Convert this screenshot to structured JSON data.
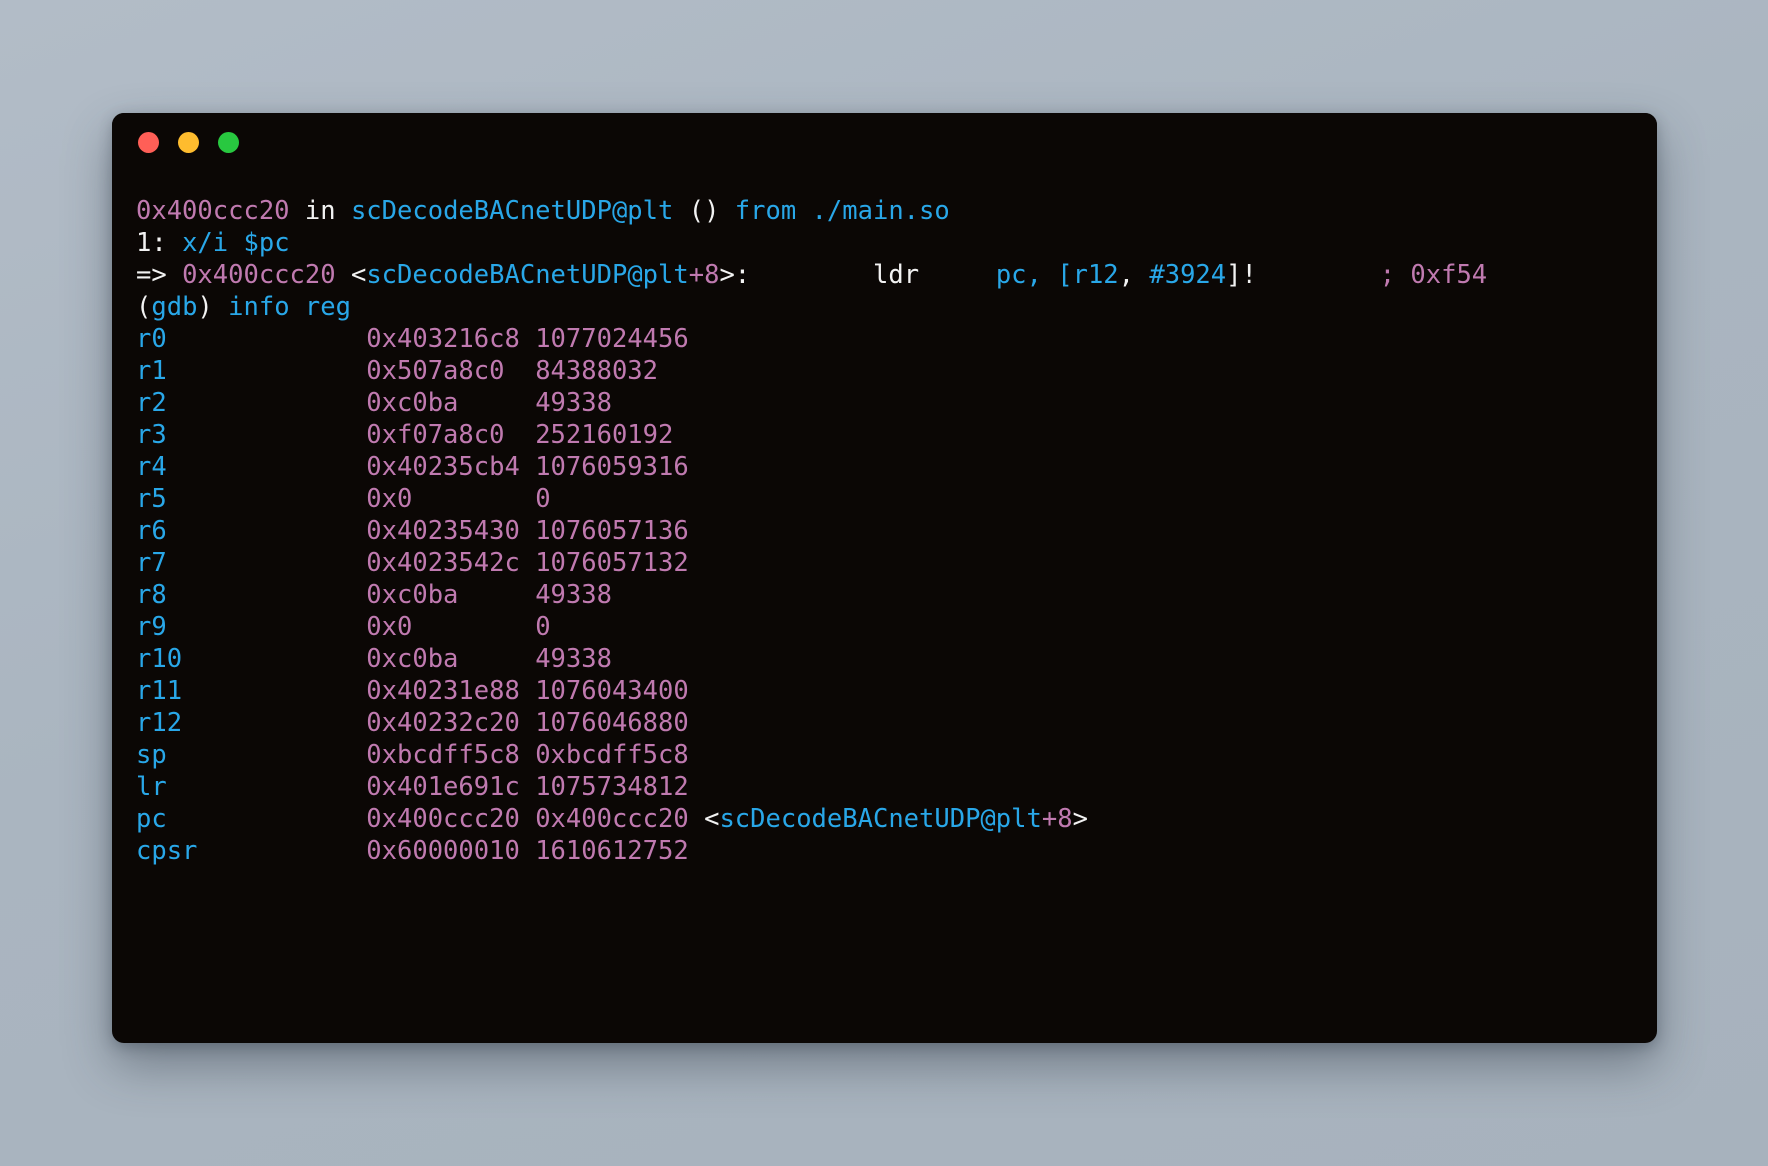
{
  "window": {
    "background_color": "#aeb9c4",
    "terminal_bg": "#0b0705",
    "titlebar": {
      "close_label": "",
      "minimize_label": "",
      "maximize_label": "",
      "close_color": "#ff5f57",
      "minimize_color": "#febc2e",
      "maximize_color": "#28c840"
    }
  },
  "colors": {
    "text": "#f2f2f2",
    "symbol_blue": "#29a7e8",
    "value_pink": "#c07ab0"
  },
  "terminal": {
    "stop_line": {
      "address": "0x400ccc20",
      "in_kw": " in ",
      "symbol": "scDecodeBACnetUDP@plt",
      "parens": " () ",
      "from_kw": "from",
      "space": " ",
      "object": "./main.so"
    },
    "display_line": {
      "number": "1: ",
      "command": "x/i",
      "space": " ",
      "register": "$pc"
    },
    "disasm_line": {
      "arrow": "=> ",
      "address": "0x400ccc20",
      "space1": " ",
      "lt": "<",
      "symbol": "scDecodeBACnetUDP",
      "plt": "@plt",
      "plus": "+8",
      "gt": ">:",
      "gap1": "        ",
      "mnemonic": "ldr",
      "gap2": "     ",
      "operands_pre": "pc, [",
      "reg_operand": "r12",
      "operands_mid": ", ",
      "immediate": "#3924",
      "operands_post": "]!",
      "gap3": "        ",
      "comment": "; 0xf54"
    },
    "prompt_line": {
      "open_paren": "(",
      "prompt": "gdb",
      "close_paren": ")",
      "space": " ",
      "command": "info reg"
    },
    "register_table": {
      "columns": [
        "name",
        "hex",
        "decimal",
        "annotation"
      ],
      "rows": [
        {
          "name": "r0",
          "hex": "0x403216c8",
          "decimal": "1077024456",
          "annotation": ""
        },
        {
          "name": "r1",
          "hex": "0x507a8c0",
          "decimal": "84388032",
          "annotation": ""
        },
        {
          "name": "r2",
          "hex": "0xc0ba",
          "decimal": "49338",
          "annotation": ""
        },
        {
          "name": "r3",
          "hex": "0xf07a8c0",
          "decimal": "252160192",
          "annotation": ""
        },
        {
          "name": "r4",
          "hex": "0x40235cb4",
          "decimal": "1076059316",
          "annotation": ""
        },
        {
          "name": "r5",
          "hex": "0x0",
          "decimal": "0",
          "annotation": ""
        },
        {
          "name": "r6",
          "hex": "0x40235430",
          "decimal": "1076057136",
          "annotation": ""
        },
        {
          "name": "r7",
          "hex": "0x4023542c",
          "decimal": "1076057132",
          "annotation": ""
        },
        {
          "name": "r8",
          "hex": "0xc0ba",
          "decimal": "49338",
          "annotation": ""
        },
        {
          "name": "r9",
          "hex": "0x0",
          "decimal": "0",
          "annotation": ""
        },
        {
          "name": "r10",
          "hex": "0xc0ba",
          "decimal": "49338",
          "annotation": ""
        },
        {
          "name": "r11",
          "hex": "0x40231e88",
          "decimal": "1076043400",
          "annotation": ""
        },
        {
          "name": "r12",
          "hex": "0x40232c20",
          "decimal": "1076046880",
          "annotation": ""
        },
        {
          "name": "sp",
          "hex": "0xbcdff5c8",
          "decimal": "0xbcdff5c8",
          "annotation": ""
        },
        {
          "name": "lr",
          "hex": "0x401e691c",
          "decimal": "1075734812",
          "annotation": ""
        },
        {
          "name": "pc",
          "hex": "0x400ccc20",
          "decimal": "0x400ccc20",
          "annotation": " <scDecodeBACnetUDP@plt+8>"
        },
        {
          "name": "cpsr",
          "hex": "0x60000010",
          "decimal": "1610612752",
          "annotation": ""
        }
      ]
    }
  }
}
